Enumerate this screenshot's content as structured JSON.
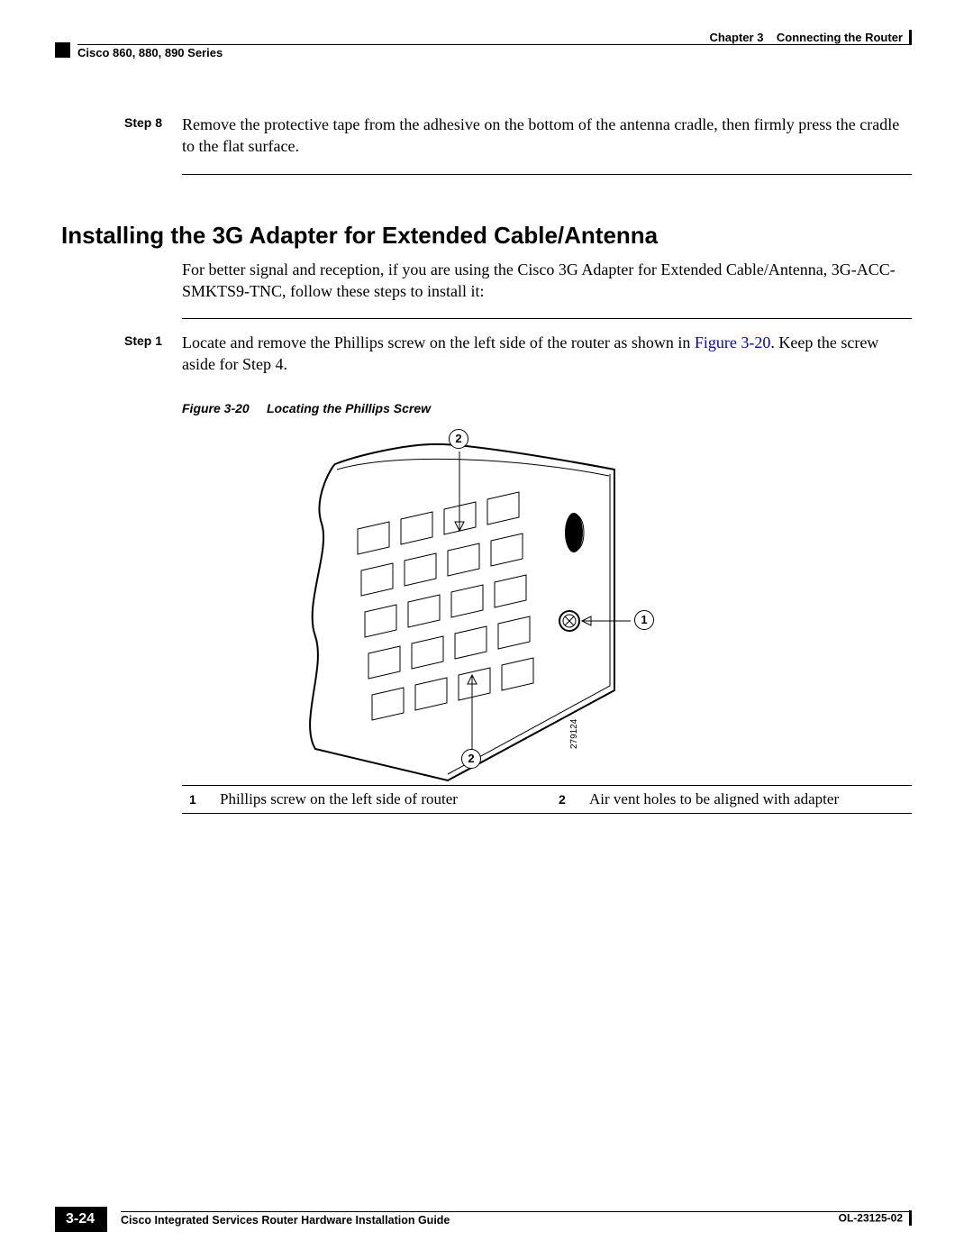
{
  "header": {
    "left": "Cisco 860, 880, 890 Series",
    "chapter_label": "Chapter 3",
    "chapter_title": "Connecting the Router"
  },
  "steps": {
    "s8_label": "Step 8",
    "s8_text": "Remove the protective tape from the adhesive on the bottom of the antenna cradle, then firmly press the cradle to the flat surface.",
    "s1_label": "Step 1",
    "s1_text_a": "Locate and remove the Phillips screw on the left side of the router as shown in ",
    "s1_link": "Figure 3-20",
    "s1_text_b": ". Keep the screw aside for Step 4."
  },
  "section_heading": "Installing the 3G Adapter for Extended Cable/Antenna",
  "intro_para": "For better signal and reception, if you are using the Cisco 3G Adapter for Extended Cable/Antenna, 3G-ACC-SMKTS9-TNC, follow these steps to install it:",
  "figure": {
    "number": "Figure 3-20",
    "title": "Locating the Phillips Screw",
    "callout_1": "1",
    "callout_2a": "2",
    "callout_2b": "2",
    "partnum": "279124"
  },
  "callout_table": {
    "n1": "1",
    "d1": "Phillips screw on the left side of router",
    "n2": "2",
    "d2": "Air vent holes to be aligned with adapter"
  },
  "footer": {
    "guide_title": "Cisco Integrated Services Router Hardware Installation Guide",
    "page_number": "3-24",
    "doc_number": "OL-23125-02"
  }
}
